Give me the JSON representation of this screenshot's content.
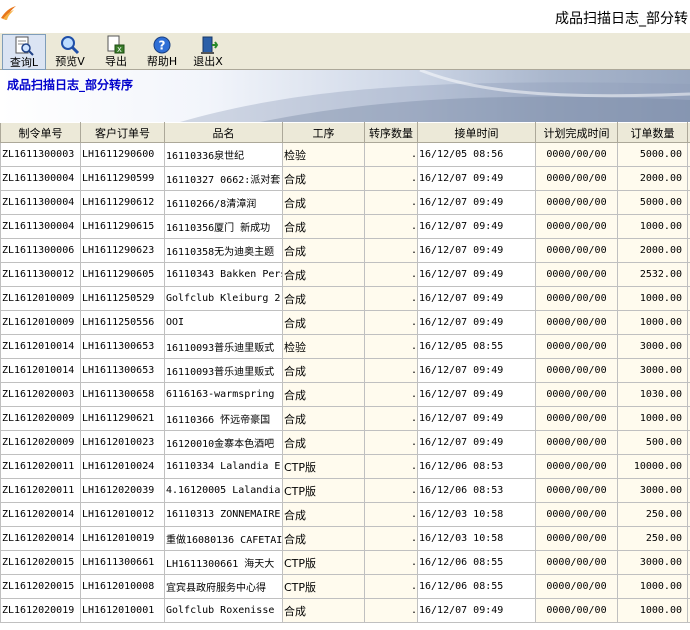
{
  "window": {
    "title": "成品扫描日志_部分转"
  },
  "toolbar": {
    "buttons": [
      {
        "label": "查询L",
        "icon": "document-search-icon"
      },
      {
        "label": "预览V",
        "icon": "magnifier-icon"
      },
      {
        "label": "导出",
        "icon": "export-icon"
      },
      {
        "label": "帮助H",
        "icon": "help-icon"
      },
      {
        "label": "退出X",
        "icon": "exit-door-icon"
      }
    ]
  },
  "banner": {
    "title": "成品扫描日志_部分转序"
  },
  "grid": {
    "columns": [
      "制令单号",
      "客户订单号",
      "品名",
      "工序",
      "转序数量",
      "接单时间",
      "计划完成时间",
      "订单数量"
    ],
    "rows": [
      [
        "ZL1611300003",
        "LH1611290600",
        "16110336泉世纪",
        "检验",
        ".",
        "16/12/05 08:56",
        "0000/00/00",
        "5000.00"
      ],
      [
        "ZL1611300004",
        "LH1611290599",
        "16110327  0662:派对套",
        "合成",
        ".",
        "16/12/07 09:49",
        "0000/00/00",
        "2000.00"
      ],
      [
        "ZL1611300004",
        "LH1611290612",
        "16110266/8清漳润",
        "合成",
        ".",
        "16/12/07 09:49",
        "0000/00/00",
        "5000.00"
      ],
      [
        "ZL1611300004",
        "LH1611290615",
        "16110356厦门 新成功",
        "合成",
        ".",
        "16/12/07 09:49",
        "0000/00/00",
        "1000.00"
      ],
      [
        "ZL1611300006",
        "LH1611290623",
        "16110358无为迪奥主题",
        "合成",
        ".",
        "16/12/07 09:49",
        "0000/00/00",
        "2000.00"
      ],
      [
        "ZL1611300012",
        "LH1611290605",
        "16110343 Bakken Pers",
        "合成",
        ".",
        "16/12/07 09:49",
        "0000/00/00",
        "2532.00"
      ],
      [
        "ZL1612010009",
        "LH1611250529",
        "Golfclub Kleiburg 2",
        "合成",
        ".",
        "16/12/07 09:49",
        "0000/00/00",
        "1000.00"
      ],
      [
        "ZL1612010009",
        "LH1611250556",
        "OOI",
        "合成",
        ".",
        "16/12/07 09:49",
        "0000/00/00",
        "1000.00"
      ],
      [
        "ZL1612010014",
        "LH1611300653",
        "16110093普乐迪里贩式",
        "检验",
        ".",
        "16/12/05 08:55",
        "0000/00/00",
        "3000.00"
      ],
      [
        "ZL1612010014",
        "LH1611300653",
        "16110093普乐迪里贩式",
        "合成",
        ".",
        "16/12/07 09:49",
        "0000/00/00",
        "3000.00"
      ],
      [
        "ZL1612020003",
        "LH1611300658",
        "6116163-warmspring",
        "合成",
        ".",
        "16/12/07 09:49",
        "0000/00/00",
        "1030.00"
      ],
      [
        "ZL1612020009",
        "LH1611290621",
        "16110366 怀远帝豪国",
        "合成",
        ".",
        "16/12/07 09:49",
        "0000/00/00",
        "1000.00"
      ],
      [
        "ZL1612020009",
        "LH1612010023",
        "16120010金寨本色酒吧",
        "合成",
        ".",
        "16/12/07 09:49",
        "0000/00/00",
        "500.00"
      ],
      [
        "ZL1612020011",
        "LH1612010024",
        "16110334 Lalandia E",
        "CTP版",
        ".",
        "16/12/06 08:53",
        "0000/00/00",
        "10000.00"
      ],
      [
        "ZL1612020011",
        "LH1612020039",
        "4.16120005 Lalandia",
        "CTP版",
        ".",
        "16/12/06 08:53",
        "0000/00/00",
        "3000.00"
      ],
      [
        "ZL1612020014",
        "LH1612010012",
        "16110313 ZONNEMAIRE",
        "合成",
        ".",
        "16/12/03 10:58",
        "0000/00/00",
        "250.00"
      ],
      [
        "ZL1612020014",
        "LH1612010019",
        "重做16080136 CAFETAI",
        "合成",
        ".",
        "16/12/03 10:58",
        "0000/00/00",
        "250.00"
      ],
      [
        "ZL1612020015",
        "LH1611300661",
        "LH1611300661 海天大",
        "CTP版",
        ".",
        "16/12/06 08:55",
        "0000/00/00",
        "3000.00"
      ],
      [
        "ZL1612020015",
        "LH1612010008",
        "宜宾县政府服务中心得",
        "CTP版",
        ".",
        "16/12/06 08:55",
        "0000/00/00",
        "1000.00"
      ],
      [
        "ZL1612020019",
        "LH1612010001",
        "Golfclub Roxenisse",
        "合成",
        ".",
        "16/12/07 09:49",
        "0000/00/00",
        "1000.00"
      ]
    ]
  }
}
